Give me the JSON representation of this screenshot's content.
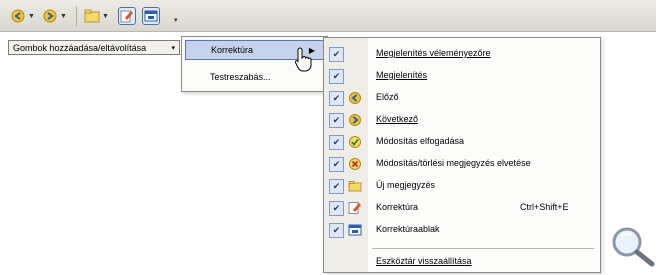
{
  "toolbar": {
    "buttons": [
      {
        "icon": "track-changes-back-icon",
        "has_dropdown": true
      },
      {
        "icon": "track-changes-forward-icon",
        "has_dropdown": true
      },
      {
        "icon": "folder-comment-icon",
        "has_dropdown": true
      },
      {
        "icon": "highlight-icon",
        "has_dropdown": false
      },
      {
        "icon": "reviewing-pane-icon",
        "has_dropdown": false
      }
    ]
  },
  "dropdown": {
    "label": "Gombok hozzáadása/eltávolítása"
  },
  "menu1": {
    "items": [
      {
        "label": "Korrektúra",
        "submenu": true
      },
      {
        "label": "Testreszabás..."
      }
    ]
  },
  "menu2": {
    "items": [
      {
        "label": "Megjelenítés véleményezőre",
        "icon": "",
        "checked": true
      },
      {
        "label": "Megjelenítés",
        "icon": "",
        "checked": true
      },
      {
        "label": "Előző",
        "icon": "previous-arrow-icon",
        "checked": true
      },
      {
        "label": "Következő",
        "icon": "next-arrow-icon",
        "checked": true
      },
      {
        "label": "Módosítás elfogadása",
        "icon": "accept-change-icon",
        "checked": true
      },
      {
        "label": "Módosítás/törlési megjegyzés elvetése",
        "icon": "reject-change-icon",
        "checked": true
      },
      {
        "label": "Új megjegyzés",
        "icon": "new-comment-icon",
        "checked": true
      },
      {
        "label": "Korrektúra",
        "icon": "track-changes-icon",
        "checked": true,
        "shortcut": "Ctrl+Shift+E"
      },
      {
        "label": "Korrektúraablak",
        "icon": "reviewing-pane-icon",
        "checked": true
      },
      {
        "label": "Eszköztár visszaállítása",
        "icon": "",
        "checked": false
      }
    ]
  },
  "colors": {
    "highlight": "#c6d3ec",
    "accent": "#5577b5",
    "toolbar": "#e3e2dc"
  }
}
